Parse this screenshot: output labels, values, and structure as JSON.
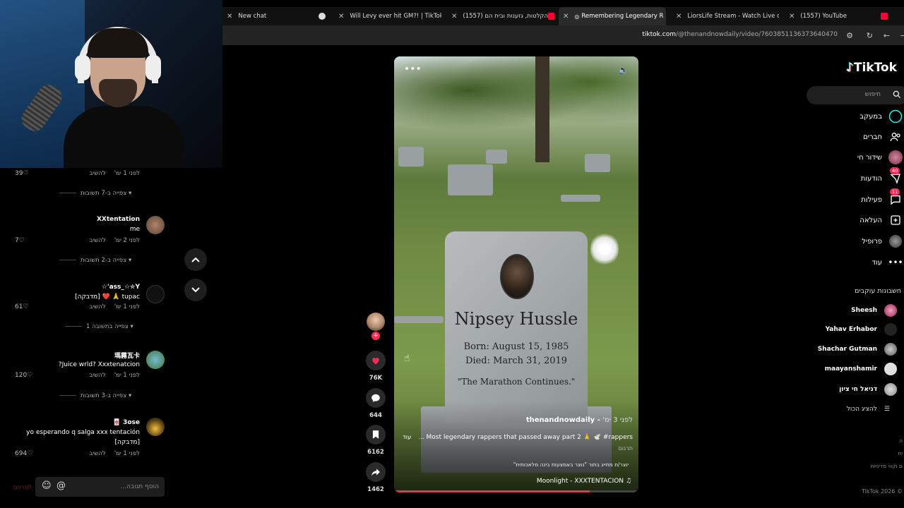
{
  "tabs": [
    {
      "title": "New chat",
      "icon": "chatgpt-icon"
    },
    {
      "title": "Will Levy ever hit GM?! | TikTok",
      "icon": "tiktok-icon"
    },
    {
      "title": "הקלטות, גזענות ובית הם (1557)",
      "icon": "youtube-icon"
    },
    {
      "title": "Remembering Legendary R",
      "icon": "tiktok-icon"
    },
    {
      "title": "LiorsLife Stream - Watch Live o",
      "icon": "kick-icon"
    },
    {
      "title": "(1557) YouTube",
      "icon": "youtube-icon"
    }
  ],
  "address": {
    "domain": "tiktok.com",
    "path": "/@thenandnowdaily/video/7603851136373640470"
  },
  "comments": [
    {
      "name": "",
      "text": "",
      "time": "לפני 1 ימ'",
      "reply": "להשיב",
      "likes": "39",
      "replies": "צפייה ב-7 תשובות",
      "avatar_color": "#555"
    },
    {
      "name": "XXtentation",
      "text": "me",
      "time": "לפני 2 ימ'",
      "reply": "להשיב",
      "likes": "7",
      "replies": "צפייה ב-2 תשובות",
      "avatar_color": "#8a6a50"
    },
    {
      "name": "ass_☆✮Y'☆",
      "text": "tupac 🙏 ❤️ [מדבקה]",
      "time": "לפני 1 ימ'",
      "reply": "להשיב",
      "likes": "61",
      "replies": "צפייה בתשובה 1",
      "avatar_color": "#222"
    },
    {
      "name": "瑪霧瓦卡",
      "text": "Juice wrld? Xxxtenatcion?",
      "time": "לפני 1 ימ'",
      "reply": "להשיב",
      "likes": "120",
      "replies": "צפייה ב-3 תשובות",
      "avatar_color": "#5a9a6a"
    },
    {
      "name": "3ose 🀄",
      "text": "yo esperando q salga xxx tentación",
      "text2": "[מדבקה]",
      "time": "לפני 1 ימ'",
      "reply": "להשיב",
      "likes": "694",
      "replies": "",
      "avatar_color": "#b08a30"
    }
  ],
  "comment_input": {
    "placeholder": "הוסף תגובה...",
    "post": "לפרסם"
  },
  "video": {
    "stone_name": "Nipsey Hussle",
    "stone_born": "Born: August 15, 1985",
    "stone_died": "Died: March 31, 2019",
    "stone_quote": "\"The Marathon Continues.\"",
    "author": "thenandnowdaily",
    "author_time": "לפני 3 ימ'",
    "caption": "Most legendary rappers that passed away part 2 🙏 🕊️ #rappers ...",
    "more": "עוד",
    "translate": "תרגום",
    "ai_label": "יוצר/ת מתייג בתור \"נוצר באמצעות בינה מלאכותית\"",
    "music": "Moonlight - XXXTENTACION",
    "progress": 0.8
  },
  "actions": {
    "likes": "76K",
    "comments": "644",
    "saves": "6162",
    "shares": "1462"
  },
  "sidebar": {
    "logo": "TikTok",
    "search_placeholder": "חיפוש",
    "nav": [
      {
        "label": "במעקב",
        "icon": "following-icon",
        "badge": ""
      },
      {
        "label": "חברים",
        "icon": "friends-icon",
        "badge": ""
      },
      {
        "label": "שידור חי",
        "icon": "live-icon",
        "badge": ""
      },
      {
        "label": "הודעות",
        "icon": "messages-icon",
        "badge": "40"
      },
      {
        "label": "פעילות",
        "icon": "activity-icon",
        "badge": "11"
      },
      {
        "label": "העלאה",
        "icon": "upload-icon",
        "badge": ""
      },
      {
        "label": "פרופיל",
        "icon": "profile-icon",
        "badge": ""
      },
      {
        "label": "עוד",
        "icon": "more-icon",
        "badge": ""
      }
    ],
    "following_title": "חשבונות עוקבים",
    "following": [
      {
        "name": "Sheesh",
        "color": "#c0406a"
      },
      {
        "name": "Yahav Erhabor",
        "color": "#777"
      },
      {
        "name": "Shachar Gutman",
        "color": "#999"
      },
      {
        "name": "maayanshamir",
        "color": "#ccc"
      },
      {
        "name": "דניאל חי ציון",
        "color": "#aaa"
      }
    ],
    "show_all": "להציג הכול",
    "footer": "TikTok 2026 ©",
    "tiny1": "ה",
    "tiny2": "ית",
    "tiny3": "ם וקווי מדיניות"
  }
}
